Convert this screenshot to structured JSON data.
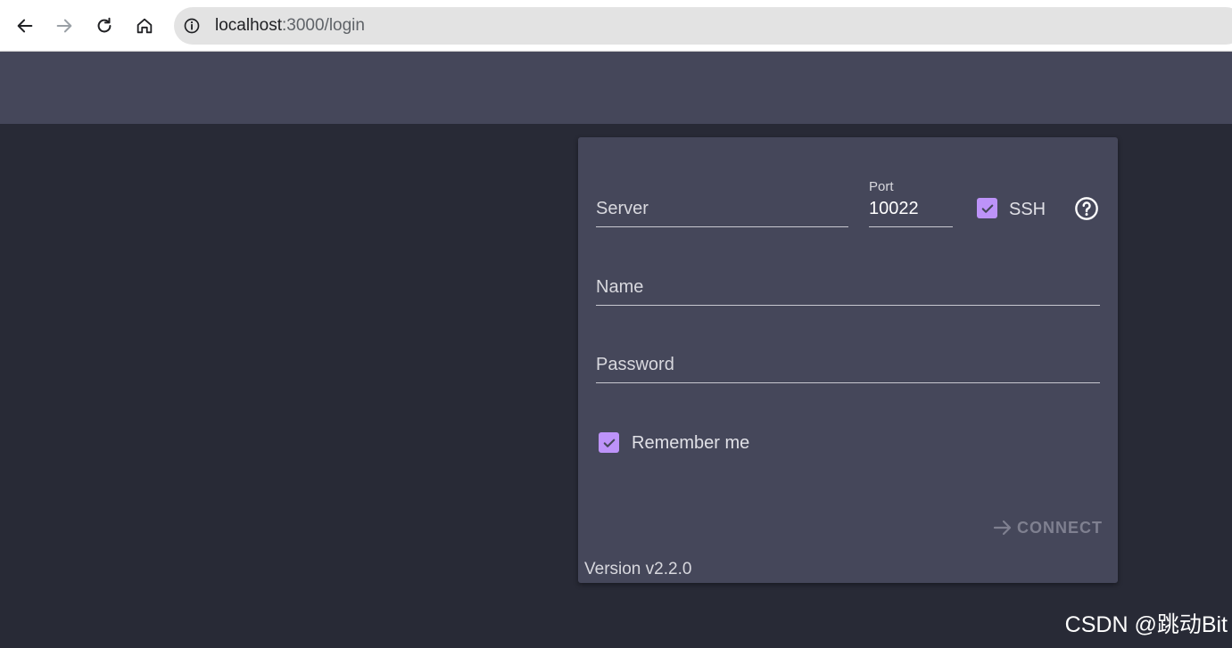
{
  "browser": {
    "url_host": "localhost",
    "url_path": ":3000/login",
    "back_icon": "arrow-left-icon",
    "forward_icon": "arrow-right-icon",
    "reload_icon": "reload-icon",
    "home_icon": "home-icon",
    "info_icon": "info-icon"
  },
  "login": {
    "server_placeholder": "Server",
    "port_label": "Port",
    "port_value": "10022",
    "ssh_label": "SSH",
    "ssh_checked": true,
    "help_icon": "help-circle-icon",
    "name_placeholder": "Name",
    "password_placeholder": "Password",
    "remember_label": "Remember me",
    "remember_checked": true,
    "connect_label": "CONNECT",
    "connect_icon": "arrow-right-icon",
    "version": "Version v2.2.0"
  },
  "watermark": "CSDN @跳动Bit",
  "colors": {
    "background": "#282a36",
    "header": "#45475a",
    "card": "#45475a",
    "accent": "#bd93f9",
    "disabled_text": "#7f8090"
  }
}
